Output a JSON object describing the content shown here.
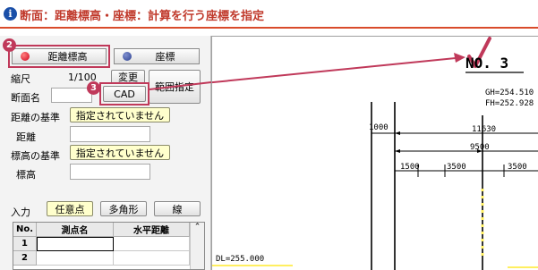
{
  "title": {
    "text": "断面：距離標高・座標：計算を行う座標を指定",
    "info_glyph": "i"
  },
  "mode_buttons": [
    {
      "label": "距離標高",
      "dot_color": "#d0021b",
      "selected": true
    },
    {
      "label": "座標",
      "dot_color": "#2a3f8f",
      "selected": false
    }
  ],
  "steps": {
    "step2": "2",
    "step3": "3"
  },
  "scale": {
    "label": "縮尺",
    "value": "1/100",
    "change_label": "変更"
  },
  "range_button": "範囲指定",
  "section_name": {
    "label": "断面名",
    "value": ""
  },
  "cad_button": "CAD",
  "distance_base": {
    "label": "距離の基準",
    "value": "指定されていません"
  },
  "distance": {
    "label": "距離",
    "value": ""
  },
  "elevation_base": {
    "label": "標高の基準",
    "value": "指定されていません"
  },
  "elevation": {
    "label": "標高",
    "value": ""
  },
  "input_row": {
    "label": "入力",
    "buttons": [
      "任意点",
      "多角形",
      "線"
    ]
  },
  "table": {
    "columns": [
      "No.",
      "測点名",
      "水平距離"
    ],
    "rows": [
      {
        "no": "1",
        "name": "",
        "distance": ""
      },
      {
        "no": "2",
        "name": "",
        "distance": ""
      }
    ]
  },
  "drawing": {
    "section_no": "NO. 3",
    "gh": "GH=254.510",
    "fh": "FH=252.928",
    "dims": [
      "1000",
      "11630",
      "9500",
      "1500",
      "3500",
      "3500"
    ],
    "datum": "DL=255.000",
    "accent_color": "#c0395a"
  }
}
